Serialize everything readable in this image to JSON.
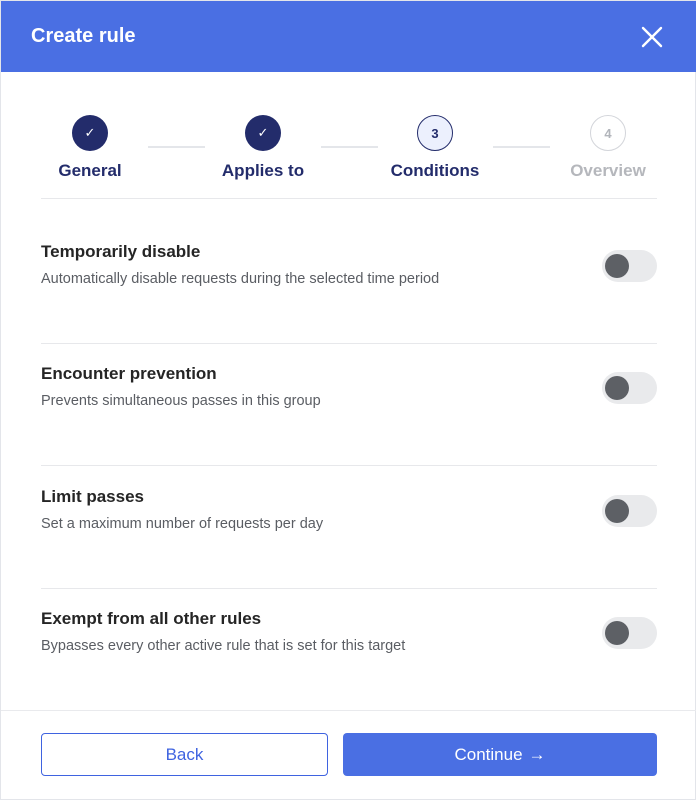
{
  "dialog": {
    "title": "Create rule"
  },
  "stepper": {
    "steps": [
      {
        "label": "General",
        "marker": "✓",
        "state": "done"
      },
      {
        "label": "Applies to",
        "marker": "✓",
        "state": "done"
      },
      {
        "label": "Conditions",
        "marker": "3",
        "state": "current"
      },
      {
        "label": "Overview",
        "marker": "4",
        "state": "upcoming"
      }
    ]
  },
  "options": [
    {
      "title": "Temporarily disable",
      "description": "Automatically disable requests during the selected time period",
      "enabled": false
    },
    {
      "title": "Encounter prevention",
      "description": "Prevents simultaneous passes in this group",
      "enabled": false
    },
    {
      "title": "Limit passes",
      "description": "Set a maximum number of requests per day",
      "enabled": false
    },
    {
      "title": "Exempt from all other rules",
      "description": "Bypasses every other active rule that is set for this target",
      "enabled": false
    }
  ],
  "footer": {
    "back_label": "Back",
    "continue_label": "Continue",
    "continue_arrow": "→"
  },
  "colors": {
    "header": "#4a6fe3",
    "step_done": "#232c6b",
    "primary_button": "#4a6fe3"
  },
  "icons": {
    "close": "close-icon",
    "arrow": "arrow-right-icon"
  }
}
